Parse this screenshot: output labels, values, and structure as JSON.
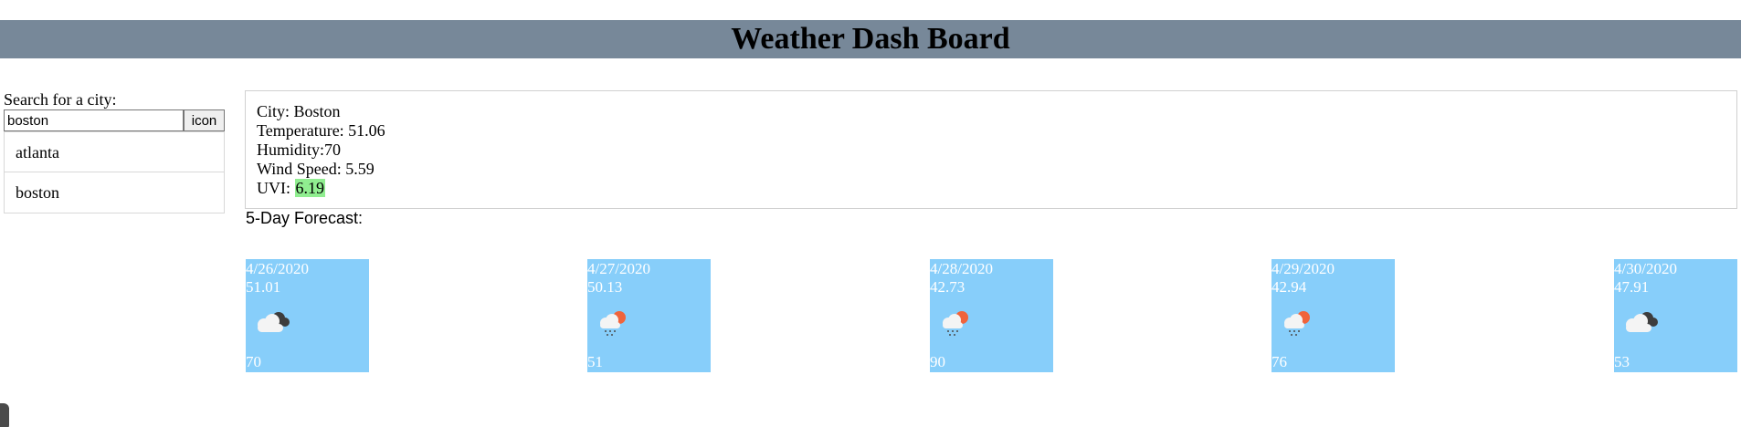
{
  "header": {
    "title": "Weather Dash Board"
  },
  "sidebar": {
    "search_label": "Search for a city:",
    "search_value": "boston",
    "search_button_label": "icon",
    "history": [
      {
        "label": "atlanta"
      },
      {
        "label": "boston"
      }
    ]
  },
  "current": {
    "city": "City: Boston",
    "temperature": "Temperature: 51.06",
    "humidity": "Humidity:70",
    "wind": "Wind Speed: 5.59",
    "uvi_label": "UVI: ",
    "uvi_value": "6.19",
    "uvi_color": "#90ee90"
  },
  "forecast": {
    "title": "5-Day Forecast:",
    "card_color": "#87cefa",
    "days": [
      {
        "date": "4/26/2020",
        "temp": "51.01",
        "humidity": "70",
        "icon": "cloudy-icon"
      },
      {
        "date": "4/27/2020",
        "temp": "50.13",
        "humidity": "51",
        "icon": "sun-rain-icon"
      },
      {
        "date": "4/28/2020",
        "temp": "42.73",
        "humidity": "90",
        "icon": "sun-rain-icon"
      },
      {
        "date": "4/29/2020",
        "temp": "42.94",
        "humidity": "76",
        "icon": "sun-rain-icon"
      },
      {
        "date": "4/30/2020",
        "temp": "47.91",
        "humidity": "53",
        "icon": "cloudy-icon"
      }
    ]
  }
}
